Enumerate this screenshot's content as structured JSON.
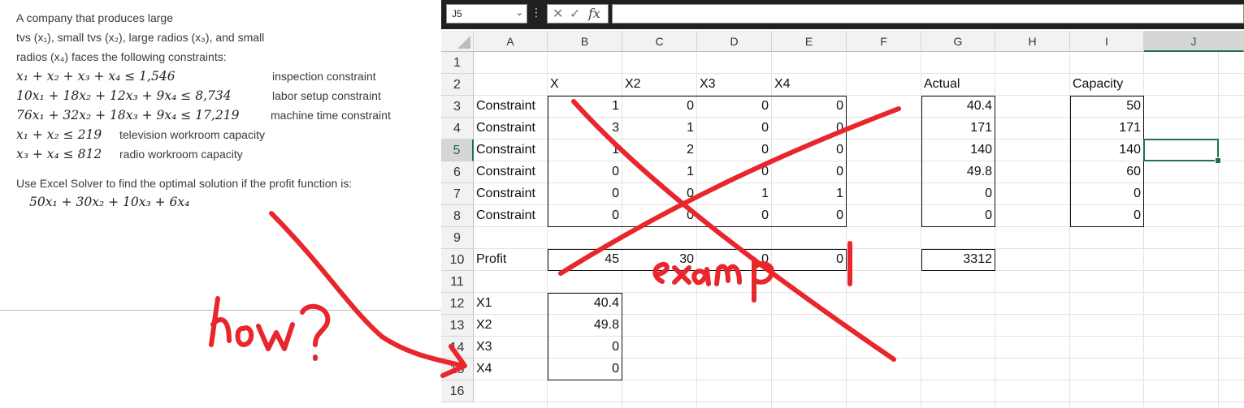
{
  "problem": {
    "intro_line1": "A company that produces large",
    "intro_line2": "tvs (x₁), small tvs (x₂), large radios (x₃), and small",
    "intro_line3": "radios (x₄) faces the following constraints:",
    "constraints": [
      {
        "expr": "x₁ + x₂ + x₃ + x₄ ≤ 1,546",
        "label": "inspection  constraint"
      },
      {
        "expr": "10x₁ + 18x₂ + 12x₃ + 9x₄ ≤ 8,734",
        "label": "labor setup  constraint"
      },
      {
        "expr": "76x₁ + 32x₂ + 18x₃ + 9x₄ ≤ 17,219",
        "label": "machine  time  constraint"
      },
      {
        "expr": "x₁ + x₂ ≤ 219",
        "label": "television  workroom  capacity"
      },
      {
        "expr": "x₃ + x₄ ≤ 812",
        "label": "radio  workroom  capacity"
      }
    ],
    "solver_text": "Use Excel Solver to find the optimal solution if the profit function is:",
    "profit_function": "50x₁ + 30x₂ + 10x₃ + 6x₄"
  },
  "excel": {
    "name_box": "J5",
    "name_box_dropdown": "⌄",
    "formula_dots": "⋮",
    "cancel_symbol": "✕",
    "enter_symbol": "✓",
    "fx_symbol": "fx",
    "formula_value": "",
    "columns": [
      "A",
      "B",
      "C",
      "D",
      "E",
      "F",
      "G",
      "H",
      "I",
      "J"
    ],
    "rows": [
      "1",
      "2",
      "3",
      "4",
      "5",
      "6",
      "7",
      "8",
      "9",
      "10",
      "11",
      "12",
      "13",
      "14",
      "15",
      "16"
    ],
    "selected_cell": "J5",
    "cells": {
      "B2": "X",
      "C2": "X2",
      "D2": "X3",
      "E2": "X4",
      "G2": "Actual",
      "I2": "Capacity",
      "A3": "Constraint",
      "B3": "1",
      "C3": "0",
      "D3": "0",
      "E3": "0",
      "G3": "40.4",
      "I3": "50",
      "A4": "Constraint",
      "B4": "3",
      "C4": "1",
      "D4": "0",
      "E4": "0",
      "G4": "171",
      "I4": "171",
      "A5": "Constraint",
      "B5": "1",
      "C5": "2",
      "D5": "0",
      "E5": "0",
      "G5": "140",
      "I5": "140",
      "A6": "Constraint",
      "B6": "0",
      "C6": "1",
      "D6": "0",
      "E6": "0",
      "G6": "49.8",
      "I6": "60",
      "A7": "Constraint",
      "B7": "0",
      "C7": "0",
      "D7": "1",
      "E7": "1",
      "G7": "0",
      "I7": "0",
      "A8": "Constraint",
      "B8": "0",
      "C8": "0",
      "D8": "0",
      "E8": "0",
      "G8": "0",
      "I8": "0",
      "A10": "Profit",
      "B10": "45",
      "C10": "30",
      "D10": "0",
      "E10": "0",
      "G10": "3312",
      "A12": "X1",
      "B12": "40.4",
      "A13": "X2",
      "B13": "49.8",
      "A14": "X3",
      "B14": "0",
      "A15": "X4",
      "B15": "0"
    }
  },
  "annotation": {
    "color": "#e8262b",
    "word_example": "example",
    "word_how": "how?"
  }
}
